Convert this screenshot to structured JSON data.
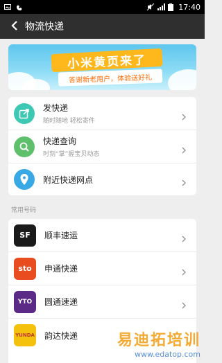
{
  "status": {
    "time": "17:40"
  },
  "header": {
    "title": "物流快递"
  },
  "banner": {
    "headline": "小米黄页来了",
    "subline": "答谢新老用户，体验送好礼"
  },
  "actions": [
    {
      "label": "发快递",
      "hint": "随时随地 轻松寄件",
      "icon": "send-package-icon",
      "color": "#3dc8b4"
    },
    {
      "label": "快递查询",
      "hint": "时刻“掌”握宝贝动态",
      "icon": "search-icon",
      "color": "#5fc06b"
    },
    {
      "label": "附近快递网点",
      "hint": "",
      "icon": "location-pin-icon",
      "color": "#39a9e6"
    }
  ],
  "common_section_label": "常用号码",
  "couriers": [
    {
      "label": "顺丰速运",
      "logo": "SF",
      "color": "#1a1a1a"
    },
    {
      "label": "申通快递",
      "logo": "sto",
      "color": "#e94c1e"
    },
    {
      "label": "圆通速递",
      "logo": "YTO",
      "color": "#5b2a86"
    },
    {
      "label": "韵达快递",
      "logo": "YUNDA",
      "color": "#f4c20d"
    }
  ],
  "watermark": {
    "line1": "易迪拓培训",
    "line2": "www.edatop.com"
  }
}
